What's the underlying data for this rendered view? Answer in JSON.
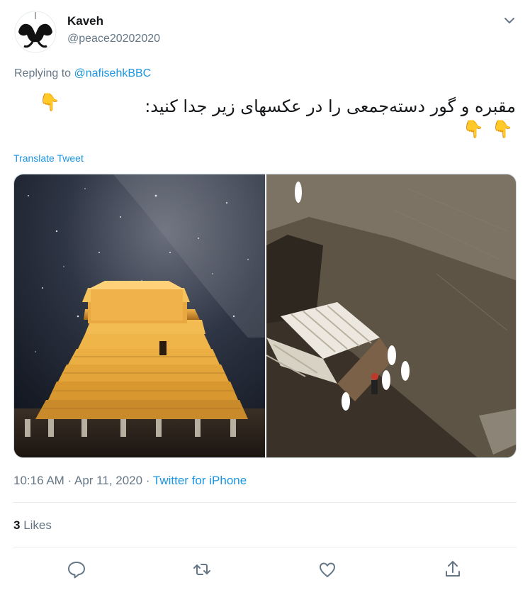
{
  "author": {
    "name": "Kaveh",
    "handle": "@peace20202020"
  },
  "reply": {
    "prefix": "Replying to ",
    "to": "@nafisehkBBC"
  },
  "tweet": {
    "text": "مقبره و گور دسته‌جمعی را در عکسهای زیر جدا کنید:",
    "emoji": "👇",
    "translate_label": "Translate Tweet"
  },
  "meta": {
    "time": "10:16 AM",
    "sep": " · ",
    "date": "Apr 11, 2020",
    "source": "Twitter for iPhone"
  },
  "stats": {
    "likes_count": "3",
    "likes_label": " Likes"
  },
  "colors": {
    "accent": "#1b95e0",
    "secondary_text": "#657786",
    "divider": "#e6ecf0"
  },
  "icons": [
    "chevron-down-icon",
    "reply-icon",
    "retweet-icon",
    "like-icon",
    "share-icon"
  ]
}
